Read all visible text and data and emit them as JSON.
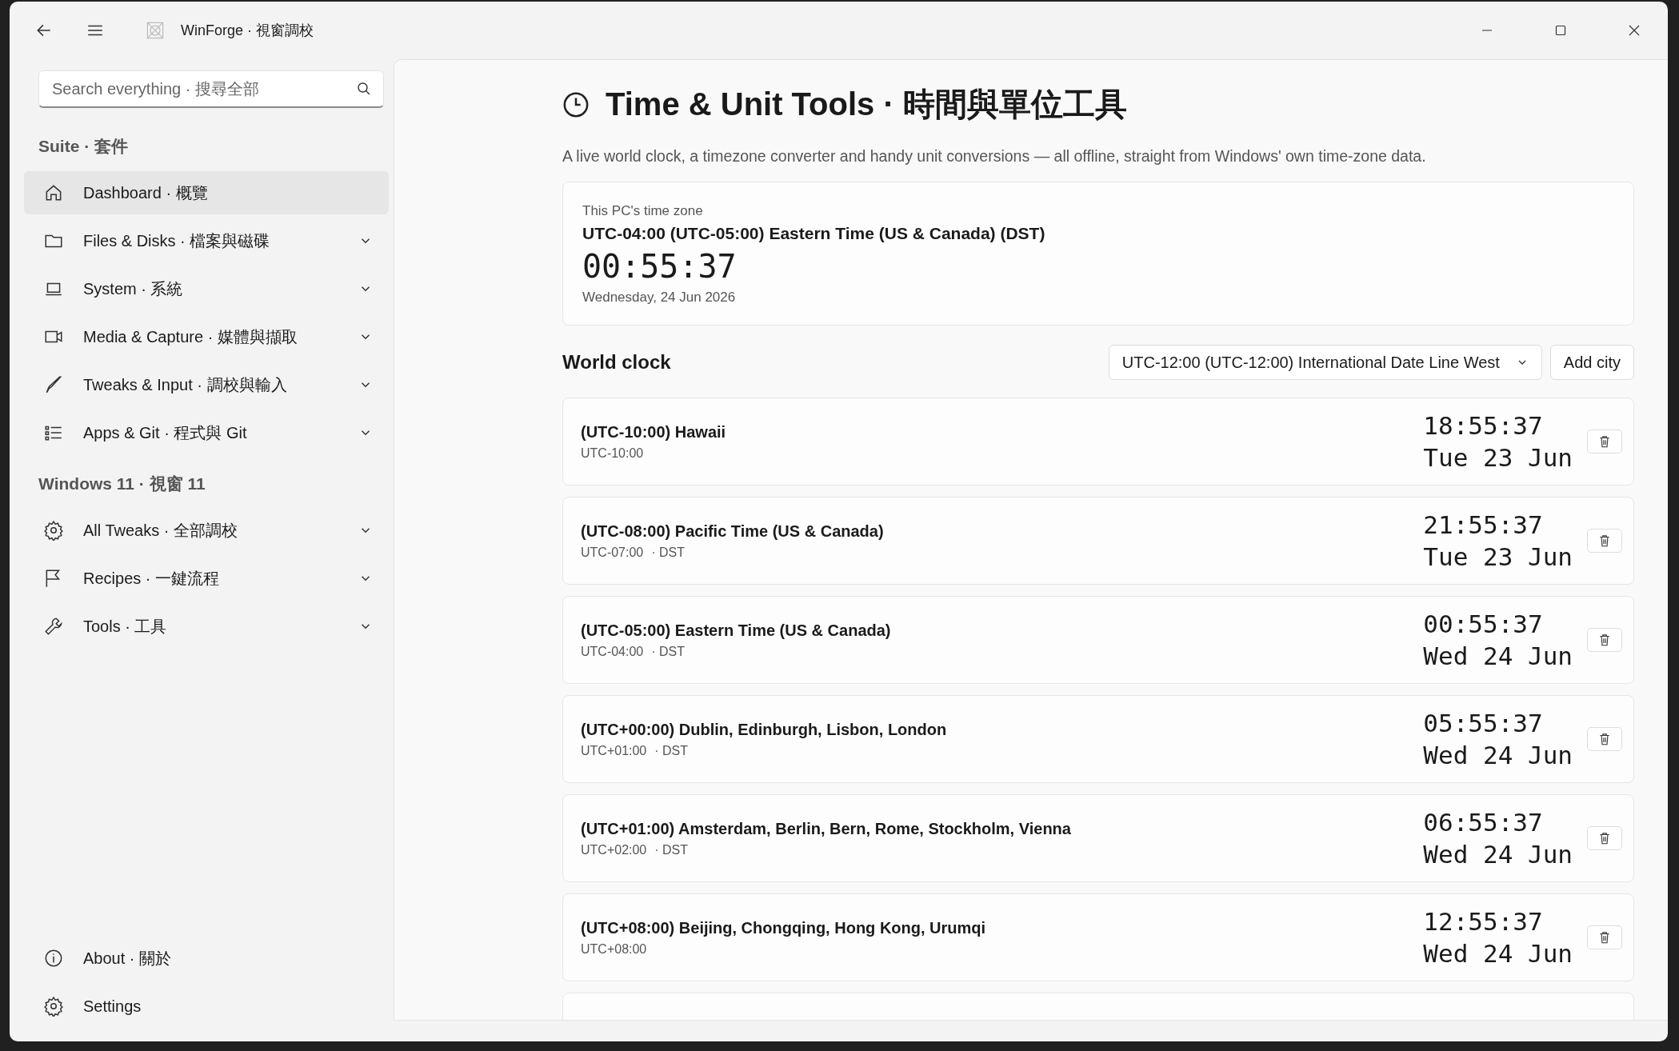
{
  "window": {
    "title": "WinForge · 視窗調校"
  },
  "sidebar": {
    "search": {
      "placeholder": "Search everything · 搜尋全部"
    },
    "sections": [
      {
        "heading": "Suite · 套件",
        "items": [
          {
            "label": "Dashboard · 概覽",
            "selected": true
          },
          {
            "label": "Files & Disks · 檔案與磁碟",
            "selected": false,
            "expanded": false
          },
          {
            "label": "System · 系統",
            "selected": false,
            "expanded": false
          },
          {
            "label": "Media & Capture · 媒體與擷取",
            "selected": false,
            "expanded": false
          },
          {
            "label": "Tweaks & Input · 調校與輸入",
            "selected": false,
            "expanded": false
          },
          {
            "label": "Apps & Git · 程式與 Git",
            "selected": false,
            "expanded": false
          }
        ]
      },
      {
        "heading": "Windows 11 · 視窗 11",
        "items": [
          {
            "label": "All Tweaks · 全部調校",
            "selected": false,
            "expanded": false
          },
          {
            "label": "Recipes · 一鍵流程",
            "selected": false,
            "expanded": false
          },
          {
            "label": "Tools · 工具",
            "selected": false,
            "expanded": false
          }
        ]
      }
    ],
    "footer": [
      {
        "label": "About · 關於",
        "selected": false
      },
      {
        "label": "Settings",
        "selected": false
      }
    ]
  },
  "page": {
    "title": "Time & Unit Tools · 時間與單位工具",
    "description": "A live world clock, a timezone converter and handy unit conversions — all offline, straight from Windows' own time-zone data.",
    "local": {
      "label": "This PC's time zone",
      "zone": "UTC-04:00  (UTC-05:00) Eastern Time (US & Canada)  (DST)",
      "time": "00:55:37",
      "date": "Wednesday, 24 Jun 2026"
    },
    "world_clock": {
      "heading": "World clock",
      "zone_select": "UTC-12:00  (UTC-12:00) International Date Line West",
      "add_button": "Add city",
      "cities": [
        {
          "name": "(UTC-10:00) Hawaii",
          "offset": "UTC-10:00",
          "time": "18:55:37",
          "date": "Tue 23 Jun"
        },
        {
          "name": "(UTC-08:00) Pacific Time (US & Canada)",
          "offset": "UTC-07:00",
          "dst": "· DST",
          "time": "21:55:37",
          "date": "Tue 23 Jun"
        },
        {
          "name": "(UTC-05:00) Eastern Time (US & Canada)",
          "offset": "UTC-04:00",
          "dst": "· DST",
          "time": "00:55:37",
          "date": "Wed 24 Jun"
        },
        {
          "name": "(UTC+00:00) Dublin, Edinburgh, Lisbon, London",
          "offset": "UTC+01:00",
          "dst": "· DST",
          "time": "05:55:37",
          "date": "Wed 24 Jun"
        },
        {
          "name": "(UTC+01:00) Amsterdam, Berlin, Bern, Rome, Stockholm, Vienna",
          "offset": "UTC+02:00",
          "dst": "· DST",
          "time": "06:55:37",
          "date": "Wed 24 Jun"
        },
        {
          "name": "(UTC+08:00) Beijing, Chongqing, Hong Kong, Urumqi",
          "offset": "UTC+08:00",
          "time": "12:55:37",
          "date": "Wed 24 Jun"
        }
      ]
    }
  }
}
